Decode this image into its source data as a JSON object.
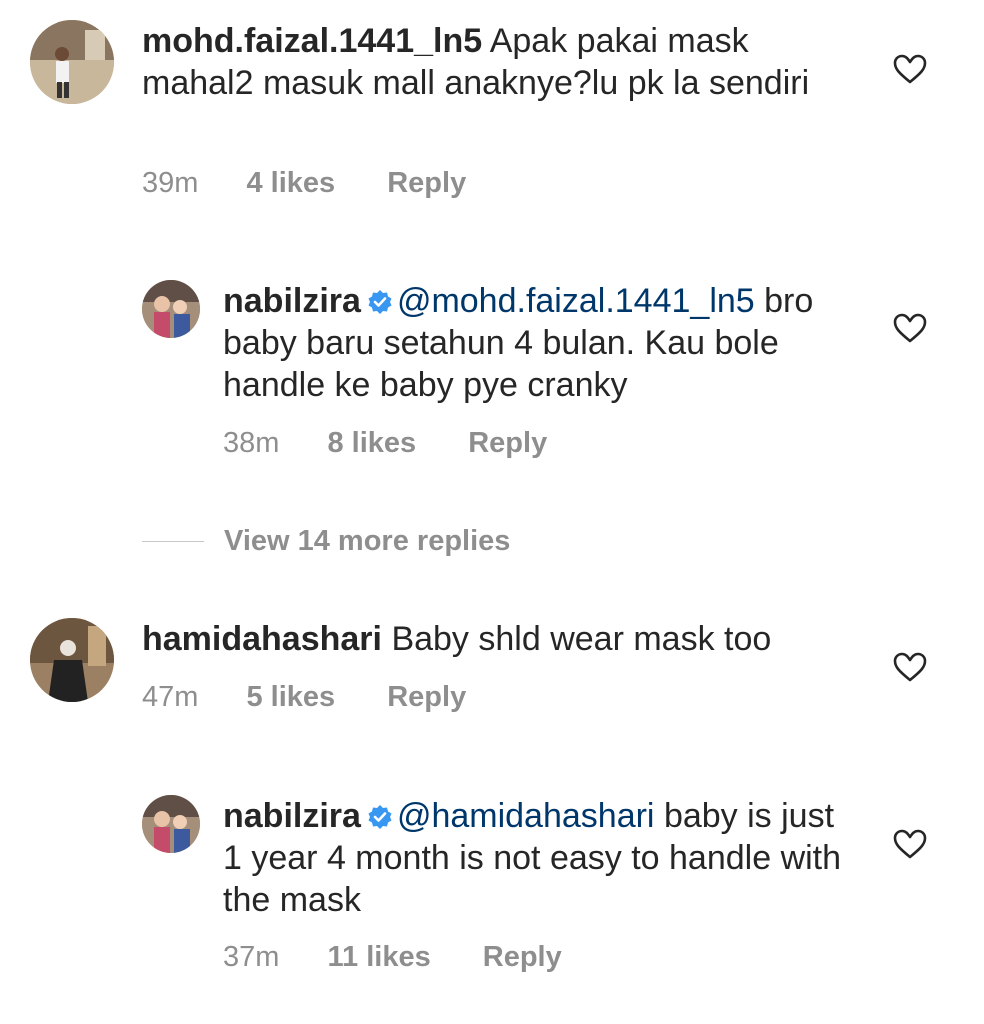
{
  "comments": [
    {
      "username": "mohd.faizal.1441_ln5",
      "verified": false,
      "mention": "",
      "text": "Apak pakai mask mahal2 masuk mall anaknye?lu pk la sendiri",
      "time": "39m",
      "likes": "4 likes",
      "reply": "Reply"
    },
    {
      "username": "nabilzira",
      "verified": true,
      "mention": "@mohd.faizal.1441_ln5",
      "text": "bro baby baru setahun 4 bulan. Kau bole handle ke baby pye cranky",
      "time": "38m",
      "likes": "8 likes",
      "reply": "Reply"
    },
    {
      "username": "hamidahashari",
      "verified": false,
      "mention": "",
      "text": "Baby shld wear mask too",
      "time": "47m",
      "likes": "5 likes",
      "reply": "Reply"
    },
    {
      "username": "nabilzira",
      "verified": true,
      "mention": "@hamidahashari",
      "text": "baby is just 1 year 4 month is not easy to handle with the mask",
      "time": "37m",
      "likes": "11 likes",
      "reply": "Reply"
    }
  ],
  "view_more": "View 14 more replies",
  "colors": {
    "username": "#262626",
    "mention": "#00376b",
    "meta": "#8e8e8e",
    "verified": "#3897f0"
  },
  "icons": {
    "like": "heart-outline-icon",
    "verified": "verified-badge-icon"
  }
}
